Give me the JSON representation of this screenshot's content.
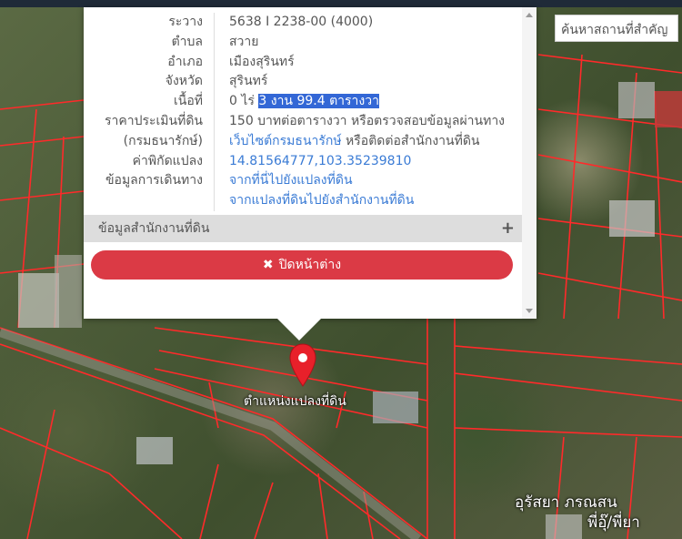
{
  "search": {
    "placeholder": "ค้นหาสถานที่สำคัญ"
  },
  "parcel": {
    "rows": [
      {
        "label": "ระวาง",
        "value": "5638 I 2238-00 (4000)"
      },
      {
        "label": "ตำบล",
        "value": "สวาย"
      },
      {
        "label": "อำเภอ",
        "value": "เมืองสุรินทร์"
      },
      {
        "label": "จังหวัด",
        "value": "สุรินทร์"
      },
      {
        "label": "เนื้อที่",
        "value_prefix": "0 ไร่ ",
        "value_highlight": "3 งาน 99.4 ตารางวา"
      },
      {
        "label": "ราคาประเมินที่ดิน",
        "value": "150 บาทต่อตารางวา หรือตรวจสอบข้อมูลผ่านทาง"
      },
      {
        "label": "(กรมธนารักษ์)",
        "value_link": "เว็บไซต์กรมธนารักษ์",
        "value_suffix": " หรือติดต่อสำนักงานที่ดิน"
      },
      {
        "label": "ค่าพิกัดแปลง",
        "value_link": "14.81564777,103.35239810"
      },
      {
        "label": "ข้อมูลการเดินทาง",
        "value_link": "จากที่นี่ไปยังแปลงที่ดิน"
      },
      {
        "label": "",
        "value_link": "จากแปลงที่ดินไปยังสำนักงานที่ดิน"
      }
    ],
    "office_section_label": "ข้อมูลสำนักงานที่ดิน",
    "close_label": "ปิดหน้าต่าง"
  },
  "map": {
    "pin_label": "ตำแหน่งแปลงที่ดิน",
    "place_labels": [
      "อุรัสยา ภรณสน",
      "พี่อุ๊/พี่ยา"
    ]
  },
  "colors": {
    "accent_red": "#db3a45",
    "link_blue": "#3a7bd5",
    "boundary_red": "#ff2020"
  }
}
